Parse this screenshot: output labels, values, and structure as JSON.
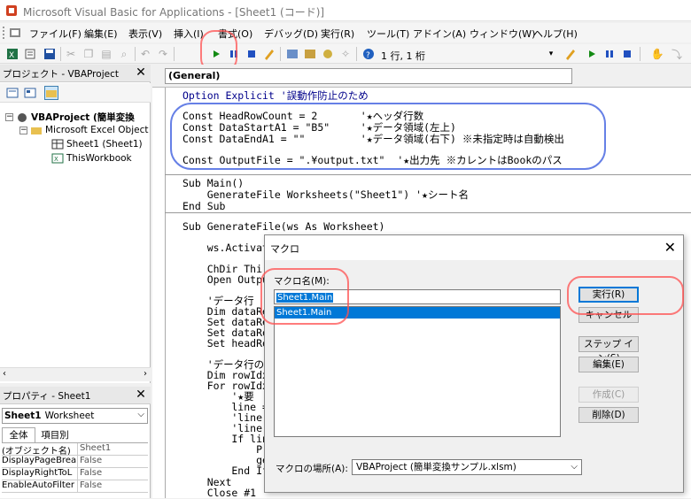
{
  "window": {
    "title": "Microsoft Visual Basic for Applications - [Sheet1 (コード)]"
  },
  "menu": {
    "items": [
      "ファイル(F)",
      "編集(E)",
      "表示(V)",
      "挿入(I)",
      "書式(O)",
      "デバッグ(D)",
      "実行(R)",
      "ツール(T)",
      "アドイン(A)",
      "ウィンドウ(W)",
      "ヘルプ(H)"
    ]
  },
  "toolbar": {
    "position": "1 行, 1 桁"
  },
  "project_panel": {
    "title": "プロジェクト - VBAProject",
    "close": "✕",
    "tree": {
      "project": "VBAProject (簡単変換",
      "folder": "Microsoft Excel Object",
      "sheet": "Sheet1 (Sheet1)",
      "workbook": "ThisWorkbook"
    }
  },
  "properties_panel": {
    "title": "プロパティ - Sheet1",
    "close": "✕",
    "object_name": "Sheet1",
    "object_type": "Worksheet",
    "tabs": [
      "全体",
      "項目別"
    ],
    "rows": [
      {
        "name": "(オブジェクト名)",
        "value": "Sheet1"
      },
      {
        "name": "DisplayPageBreak",
        "value": "False"
      },
      {
        "name": "DisplayRightToL",
        "value": "False"
      },
      {
        "name": "EnableAutoFilter",
        "value": "False"
      }
    ]
  },
  "code_window": {
    "general": "(General)",
    "lines": {
      "l1": "Option Explicit '誤動作防止のため",
      "l2": "Const HeadRowCount = 2       '★ヘッダ行数",
      "l3": "Const DataStartA1 = \"B5\"     '★データ領域(左上)",
      "l4": "Const DataEndA1 = \"\"         '★データ領域(右下) ※未指定時は自動検出",
      "l5": "Const OutputFile = \".¥output.txt\"  '★出力先 ※カレントはBookのパス",
      "l6": "Sub Main()",
      "l7": "    GenerateFile Worksheets(\"Sheet1\") '★シート名",
      "l8": "End Sub",
      "l9": "Sub GenerateFile(ws As Worksheet)",
      "l10": "    ws.Activat",
      "l11": "    ChDir Thi",
      "l12": "    Open Outpu",
      "l13": "    'データ行",
      "l14": "    Dim dataRe",
      "l15": "    Set dataRe",
      "l16": "    Set dataRo",
      "l17": "    Set headRo",
      "l18": "    'データ行の",
      "l19": "    Dim rowIdx",
      "l20": "    For rowIdx",
      "l21": "        '★要",
      "l22": "        line =",
      "l23": "        'line",
      "l24": "        'line",
      "l25": "        If lin",
      "l26": "            Pr",
      "l27": "            ge",
      "l28": "        End If",
      "l29": "    Next",
      "l30": "    Close #1"
    }
  },
  "macro_dialog": {
    "title": "マクロ",
    "close": "✕",
    "name_label": "マクロ名(M):",
    "name_value": "Sheet1.Main",
    "list": [
      "Sheet1.Main"
    ],
    "buttons": {
      "run": "実行(R)",
      "cancel": "キャンセル",
      "step": "ステップ イン(S)",
      "edit": "編集(E)",
      "create": "作成(C)",
      "delete": "削除(D)"
    },
    "location_label": "マクロの場所(A):",
    "location_value": "VBAProject (簡単変換サンプル.xlsm)"
  },
  "colors": {
    "keyword": "#00008b",
    "comment": "#006400",
    "selection": "#0078d7",
    "annotation_red": "#ff5050",
    "annotation_blue": "#4060e0"
  }
}
